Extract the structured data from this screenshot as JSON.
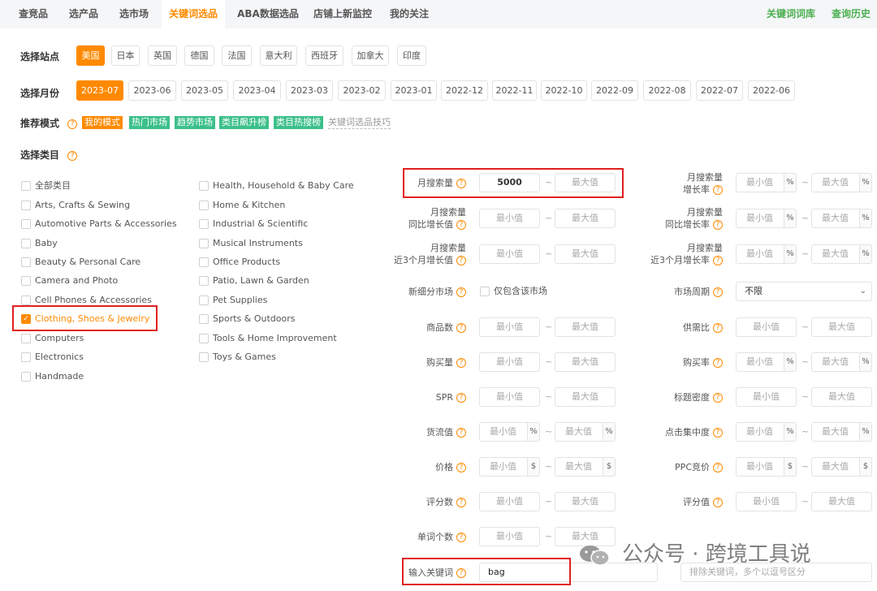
{
  "nav": {
    "tabs": [
      "查竞品",
      "选产品",
      "选市场",
      "关键词选品",
      "ABA数据选品",
      "店铺上新监控",
      "我的关注"
    ],
    "right": [
      "关键词词库",
      "查询历史"
    ]
  },
  "site": {
    "label": "选择站点",
    "options": [
      "美国",
      "日本",
      "英国",
      "德国",
      "法国",
      "意大利",
      "西班牙",
      "加拿大",
      "印度"
    ]
  },
  "month": {
    "label": "选择月份",
    "options": [
      "2023-07",
      "2023-06",
      "2023-05",
      "2023-04",
      "2023-03",
      "2023-02",
      "2023-01",
      "2022-12",
      "2022-11",
      "2022-10",
      "2022-09",
      "2022-08",
      "2022-07",
      "2022-06"
    ]
  },
  "mode": {
    "label": "推荐模式",
    "tags": [
      "我的模式",
      "热门市场",
      "趋势市场",
      "类目飙升榜",
      "类目热搜榜"
    ],
    "link": "关键词选品技巧"
  },
  "category": {
    "label": "选择类目",
    "col1": [
      "全部类目",
      "Arts, Crafts & Sewing",
      "Automotive Parts & Accessories",
      "Baby",
      "Beauty & Personal Care",
      "Camera and Photo",
      "Cell Phones & Accessories",
      "Clothing, Shoes & Jewelry",
      "Computers",
      "Electronics",
      "Handmade"
    ],
    "col2": [
      "Health, Household & Baby Care",
      "Home & Kitchen",
      "Industrial & Scientific",
      "Musical Instruments",
      "Office Products",
      "Patio, Lawn & Garden",
      "Pet Supplies",
      "Sports & Outdoors",
      "Tools & Home Improvement",
      "Toys & Games"
    ],
    "selected": "Clothing, Shoes & Jewelry"
  },
  "common": {
    "min": "最小值",
    "max": "最大值",
    "tilde": "~",
    "pct": "%",
    "usd": "$",
    "qmark": "?",
    "check": "✓"
  },
  "filters": {
    "monthly_search": {
      "label": "月搜索量",
      "min_value": "5000"
    },
    "monthly_search_growth": {
      "line1": "月搜索量",
      "line2": "增长率"
    },
    "yoy_growth": {
      "line1": "月搜索量",
      "line2": "同比增长值"
    },
    "yoy_growth_rate": {
      "line1": "月搜索量",
      "line2": "同比增长率"
    },
    "three_month_growth": {
      "line1": "月搜索量",
      "line2": "近3个月增长值"
    },
    "three_month_growth_rate": {
      "line1": "月搜索量",
      "line2": "近3个月增长率"
    },
    "new_segment": {
      "label": "新细分市场",
      "checkbox": "仅包含该市场"
    },
    "market_cycle": {
      "label": "市场周期",
      "value": "不限"
    },
    "product_count": {
      "label": "商品数"
    },
    "supply_demand": {
      "label": "供需比"
    },
    "purchase_volume": {
      "label": "购买量"
    },
    "purchase_rate": {
      "label": "购买率"
    },
    "spr": {
      "label": "SPR"
    },
    "title_density": {
      "label": "标题密度"
    },
    "cargo_value": {
      "label": "货流值"
    },
    "click_concentration": {
      "label": "点击集中度"
    },
    "price": {
      "label": "价格"
    },
    "ppc_bid": {
      "label": "PPC竞价"
    },
    "review_count": {
      "label": "评分数"
    },
    "rating": {
      "label": "评分值"
    },
    "word_count": {
      "label": "单词个数"
    },
    "keyword": {
      "label": "输入关键词",
      "value": "bag",
      "exclude_placeholder": "排除关键词，多个以逗号区分"
    }
  },
  "watermark": {
    "text": "公众号 · 跨境工具说"
  }
}
